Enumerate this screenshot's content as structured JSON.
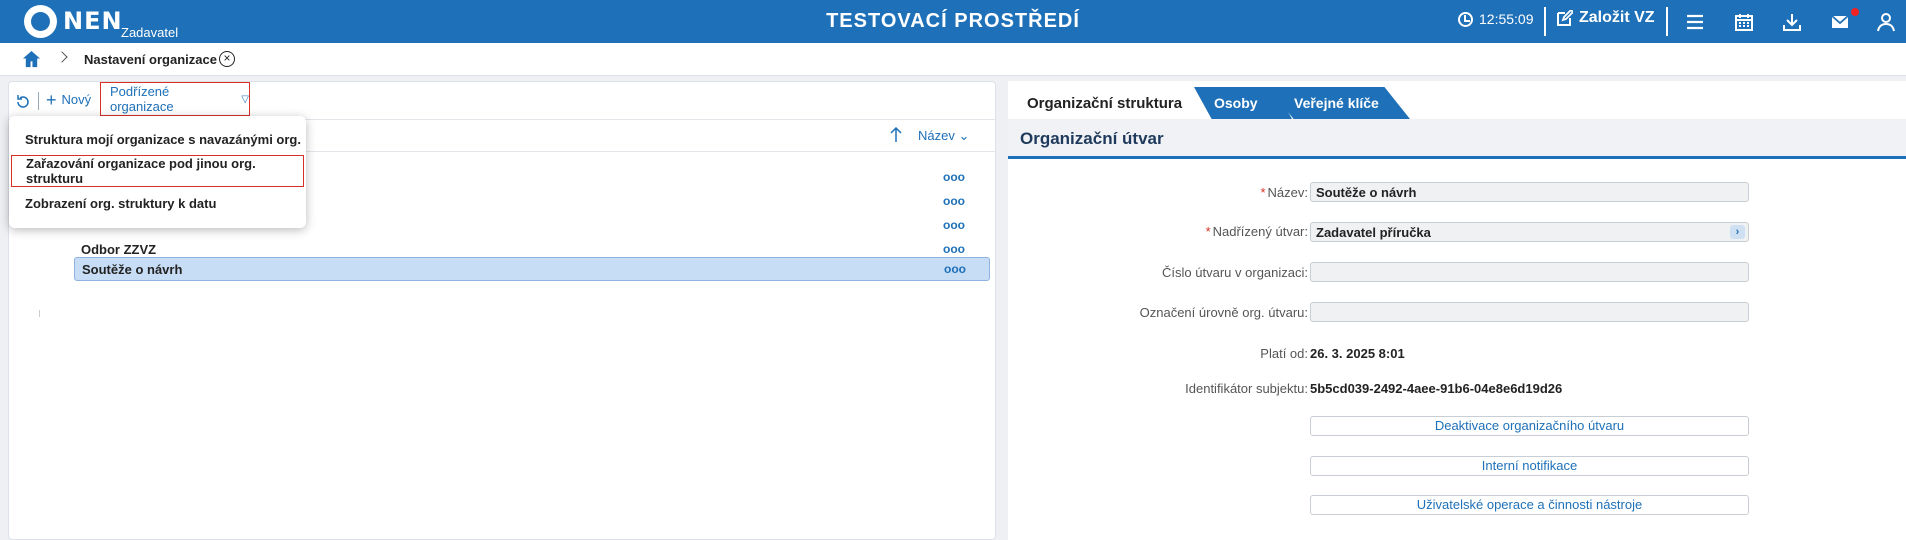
{
  "header": {
    "brand": "NEN",
    "brand_sub": "Zadavatel",
    "environment": "TESTOVACÍ PROSTŘEDÍ",
    "time": "12:55:09",
    "create_label": "Založit VZ",
    "icons": [
      "clock-icon",
      "edit-icon",
      "menu-icon",
      "calendar-icon",
      "download-icon",
      "mail-icon",
      "user-icon"
    ],
    "accent": "#1e70b8"
  },
  "breadcrumb": {
    "current": "Nastavení organizace"
  },
  "left": {
    "new_label": "Nový",
    "sub_org_label": "Podřízené organizace",
    "sort_label": "Název",
    "dropdown": [
      "Struktura mojí organizace s navazánými org.",
      "Zařazování organizace pod jinou org. strukturu",
      "Zobrazení org. struktury k datu"
    ],
    "tree": [
      {
        "label": ""
      },
      {
        "label": ""
      },
      {
        "label": ""
      },
      {
        "label": "Odbor ZZVZ"
      },
      {
        "label": "Soutěže o návrh",
        "selected": true
      }
    ]
  },
  "right": {
    "tabs": [
      "Organizační struktura",
      "Osoby",
      "Veřejné klíče"
    ],
    "section_title": "Organizační útvar",
    "fields": {
      "name_label": "Název:",
      "name_value": "Soutěže o návrh",
      "parent_label": "Nadřízený útvar:",
      "parent_value": "Zadavatel příručka",
      "number_label": "Číslo útvaru v organizaci:",
      "number_value": "",
      "level_label": "Označení úrovně org. útvaru:",
      "level_value": "",
      "valid_label": "Platí od:",
      "valid_value": "26. 3. 2025 8:01",
      "id_label": "Identifikátor subjektu:",
      "id_value": "5b5cd039-2492-4aee-91b6-04e8e6d19d26"
    },
    "buttons": [
      "Deaktivace organizačního útvaru",
      "Interní notifikace",
      "Uživatelské operace a činnosti nástroje"
    ]
  }
}
